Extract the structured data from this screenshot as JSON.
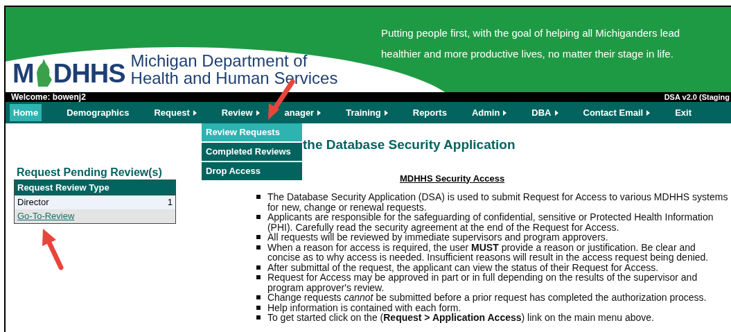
{
  "banner": {
    "logo": {
      "left": "M",
      "right": "DHHS"
    },
    "org_name": [
      "Michigan Department of",
      "Health and Human Services"
    ],
    "tagline": [
      "Putting people first, with the goal of helping all Michiganders lead",
      "healthier and more productive lives, no matter their stage in life."
    ]
  },
  "user_bar": {
    "welcome": "Welcome: bowenj2",
    "version": "DSA v2.0 (Staging"
  },
  "nav": [
    {
      "label": "Home",
      "selected": true,
      "has_submenu": false
    },
    {
      "label": "Demographics",
      "selected": false,
      "has_submenu": false
    },
    {
      "label": "Request",
      "selected": false,
      "has_submenu": true
    },
    {
      "label": "Review",
      "selected": false,
      "has_submenu": true
    },
    {
      "label": "anager",
      "selected": false,
      "has_submenu": true
    },
    {
      "label": "Training",
      "selected": false,
      "has_submenu": true
    },
    {
      "label": "Reports",
      "selected": false,
      "has_submenu": false
    },
    {
      "label": "Admin",
      "selected": false,
      "has_submenu": true
    },
    {
      "label": "DBA",
      "selected": false,
      "has_submenu": true
    },
    {
      "label": "Contact Email",
      "selected": false,
      "has_submenu": true
    },
    {
      "label": "Exit",
      "selected": false,
      "has_submenu": false
    }
  ],
  "dropdown": [
    {
      "label": "Review Requests",
      "selected": true
    },
    {
      "label": "Completed Reviews",
      "selected": false
    },
    {
      "label": "Drop Access",
      "selected": false
    }
  ],
  "page_title": "the Database Security Application",
  "pending": {
    "title": "Request Pending Review(s)",
    "column": "Request Review Type",
    "rows": [
      {
        "type": "Director",
        "count": "1"
      }
    ],
    "link": "Go-To-Review"
  },
  "security": {
    "heading": "MDHHS Security Access",
    "bullets": [
      "The Database Security Application (DSA) is used to submit Request for Access to various MDHHS systems for new, change or renewal requests.",
      "Applicants are responsible for the safeguarding of confidential, sensitive or Protected Health Information (PHI).  Carefully read the security agreement at the end of the Request for Access.",
      "All requests will be reviewed by immediate supervisors and program approvers.",
      "When a reason for access is required, the user **MUST** provide a reason or justification.  Be clear and concise as to why access is needed.  Insufficient reasons will result in the access request being denied.",
      "After submittal of the request, the applicant can view the status of their Request for Access.",
      "Request for Access may be approved in part or in full depending on the results of the supervisor and program approver's review.",
      "Change requests *cannot* be submitted before a prior request has completed the authorization process.",
      "Help information is contained with each form.",
      "To get started click on the (**Request > Application Access**) link on the main menu above."
    ]
  }
}
